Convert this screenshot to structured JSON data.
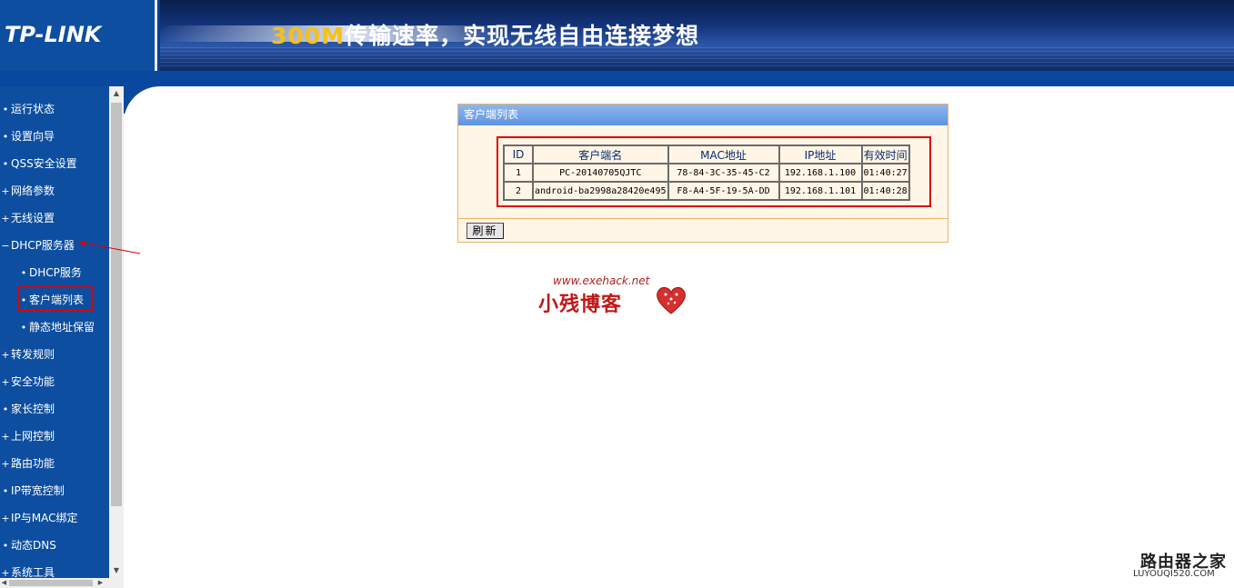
{
  "header": {
    "logo": "TP-LINK",
    "slogan_highlight": "300M",
    "slogan_rest": "传输速率，实现无线自由连接梦想"
  },
  "sidebar": {
    "items": [
      {
        "label": "运行状态",
        "bullet": "•"
      },
      {
        "label": "设置向导",
        "bullet": "•"
      },
      {
        "label": "QSS安全设置",
        "bullet": "•"
      },
      {
        "label": "网络参数",
        "bullet": "+"
      },
      {
        "label": "无线设置",
        "bullet": "+"
      },
      {
        "label": "DHCP服务器",
        "bullet": "−"
      },
      {
        "label": "DHCP服务",
        "bullet": "•"
      },
      {
        "label": "客户端列表",
        "bullet": "•"
      },
      {
        "label": "静态地址保留",
        "bullet": "•"
      },
      {
        "label": "转发规则",
        "bullet": "+"
      },
      {
        "label": "安全功能",
        "bullet": "+"
      },
      {
        "label": "家长控制",
        "bullet": "•"
      },
      {
        "label": "上网控制",
        "bullet": "+"
      },
      {
        "label": "路由功能",
        "bullet": "+"
      },
      {
        "label": "IP带宽控制",
        "bullet": "•"
      },
      {
        "label": "IP与MAC绑定",
        "bullet": "+"
      },
      {
        "label": "动态DNS",
        "bullet": "•"
      },
      {
        "label": "系统工具",
        "bullet": "+"
      }
    ]
  },
  "panel": {
    "title": "客户端列表",
    "columns": [
      "ID",
      "客户端名",
      "MAC地址",
      "IP地址",
      "有效时间"
    ],
    "rows": [
      [
        "1",
        "PC-20140705QJTC",
        "78-84-3C-35-45-C2",
        "192.168.1.100",
        "01:40:27"
      ],
      [
        "2",
        "android-ba2998a28420e495",
        "F8-A4-5F-19-5A-DD",
        "192.168.1.101",
        "01:40:28"
      ]
    ],
    "refresh_label": "刷新"
  },
  "watermark": {
    "url": "www.exehack.net",
    "name": "小残博客"
  },
  "corner_logo": {
    "name": "路由器之家",
    "url": "LUYOUQI520.COM"
  },
  "colors": {
    "sidebar_bg": "#0d4ea0",
    "highlight_red": "#e00000",
    "panel_bg": "#fff6e7",
    "panel_border": "#f0b167",
    "panel_title_bg": "#5e94e0"
  }
}
